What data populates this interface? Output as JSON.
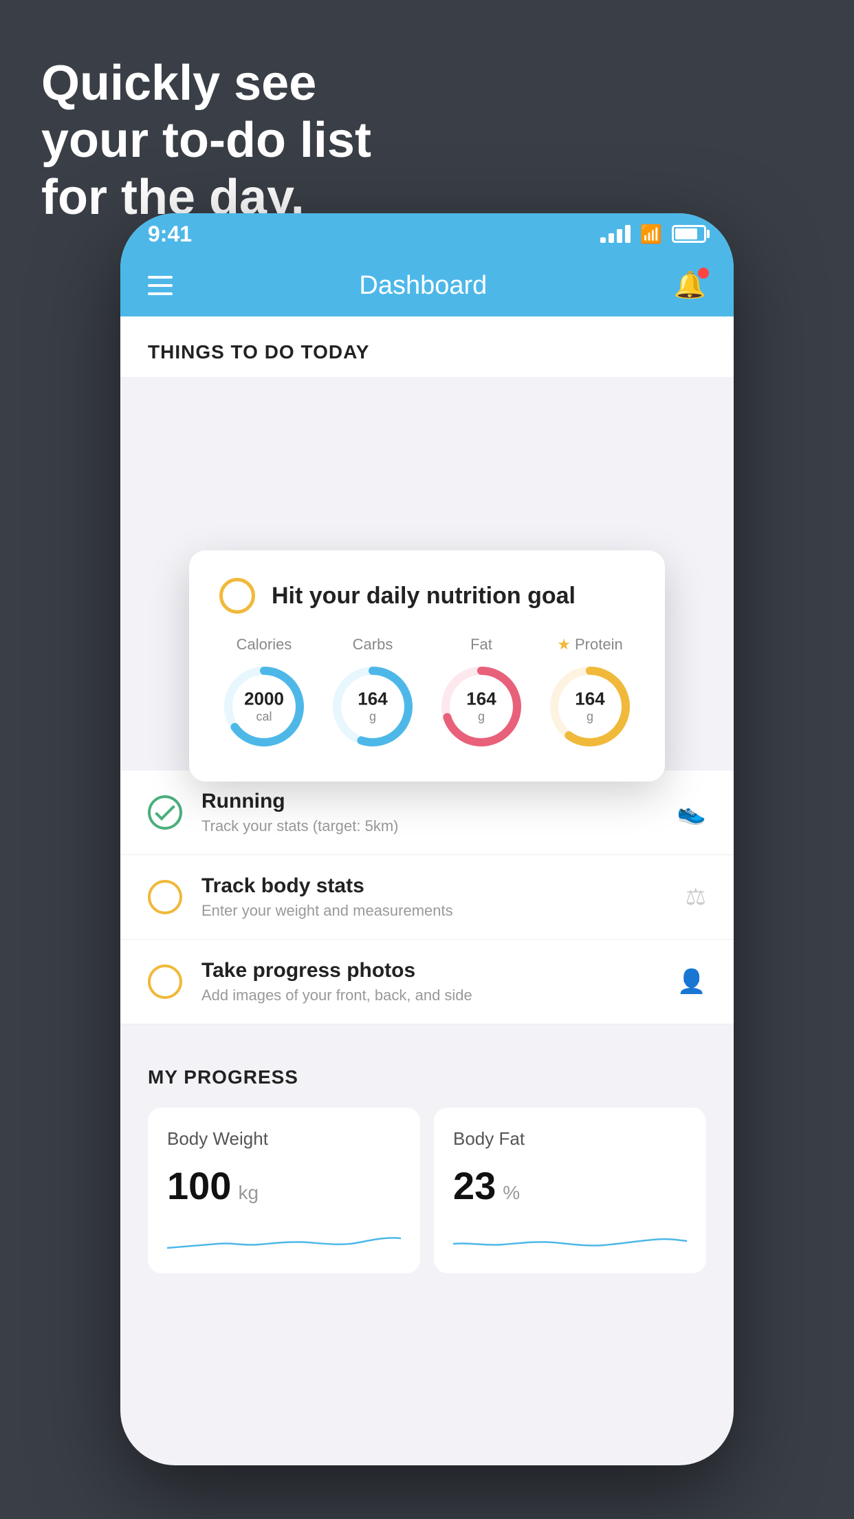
{
  "background": {
    "color": "#3a3f47"
  },
  "headline": {
    "line1": "Quickly see",
    "line2": "your to-do list",
    "line3": "for the day."
  },
  "phone": {
    "status_bar": {
      "time": "9:41",
      "signal_bars": [
        4,
        8,
        12,
        16
      ],
      "wifi": "wifi",
      "battery": 80
    },
    "header": {
      "menu_label": "menu",
      "title": "Dashboard",
      "bell_label": "notifications"
    },
    "things_section": {
      "title": "THINGS TO DO TODAY"
    },
    "nutrition_card": {
      "circle_color": "#f0b93a",
      "title": "Hit your daily nutrition goal",
      "macros": [
        {
          "label": "Calories",
          "value": "2000",
          "unit": "cal",
          "color": "#4db8e8",
          "pct": 65,
          "star": false
        },
        {
          "label": "Carbs",
          "value": "164",
          "unit": "g",
          "color": "#4db8e8",
          "pct": 55,
          "star": false
        },
        {
          "label": "Fat",
          "value": "164",
          "unit": "g",
          "color": "#e8607a",
          "pct": 70,
          "star": false
        },
        {
          "label": "Protein",
          "value": "164",
          "unit": "g",
          "color": "#f0b93a",
          "pct": 60,
          "star": true
        }
      ]
    },
    "todo_items": [
      {
        "id": "running",
        "title": "Running",
        "subtitle": "Track your stats (target: 5km)",
        "circle_style": "green",
        "checked": true,
        "icon": "👟"
      },
      {
        "id": "body-stats",
        "title": "Track body stats",
        "subtitle": "Enter your weight and measurements",
        "circle_style": "yellow",
        "checked": false,
        "icon": "⚖"
      },
      {
        "id": "progress-photos",
        "title": "Take progress photos",
        "subtitle": "Add images of your front, back, and side",
        "circle_style": "yellow",
        "checked": false,
        "icon": "👤"
      }
    ],
    "progress_section": {
      "title": "MY PROGRESS",
      "cards": [
        {
          "id": "body-weight",
          "title": "Body Weight",
          "value": "100",
          "unit": "kg"
        },
        {
          "id": "body-fat",
          "title": "Body Fat",
          "value": "23",
          "unit": "%"
        }
      ]
    }
  }
}
